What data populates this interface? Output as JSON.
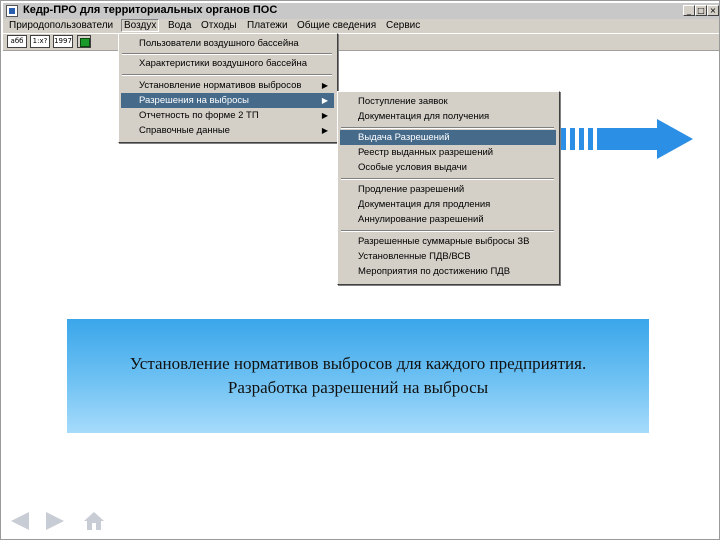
{
  "window": {
    "title": "Кедр-ПРО для территориальных органов ПОС"
  },
  "menubar": {
    "items": [
      "Природопользователи",
      "Воздух",
      "Вода",
      "Отходы",
      "Платежи",
      "Общие сведения",
      "Сервис"
    ],
    "active": "Воздух"
  },
  "toolbar": {
    "buttons": [
      "абб",
      "1:x?",
      "1997",
      ""
    ]
  },
  "air_menu": {
    "items": [
      {
        "label": "Пользователи воздушного бассейна",
        "submenu": false
      },
      {
        "label": "Характеристики воздушного бассейна",
        "submenu": false
      },
      {
        "label": "Установление нормативов выбросов",
        "submenu": true
      },
      {
        "label": "Разрешения на выбросы",
        "submenu": true,
        "highlighted": true
      },
      {
        "label": "Отчетность по форме 2 ТП",
        "submenu": true
      },
      {
        "label": "Справочные данные",
        "submenu": true
      }
    ]
  },
  "permits_menu": {
    "items": [
      {
        "label": "Поступление заявок"
      },
      {
        "label": "Документация для получения"
      },
      {
        "label": "Выдача Разрешений",
        "highlighted": true
      },
      {
        "label": "Реестр выданных разрешений"
      },
      {
        "label": "Особые условия выдачи"
      },
      {
        "label": "Продление разрешений"
      },
      {
        "label": "Документация для продления"
      },
      {
        "label": "Аннулирование разрешений"
      },
      {
        "label": "Разрешенные суммарные выбросы ЗВ"
      },
      {
        "label": "Установленные ПДВ/ВСВ"
      },
      {
        "label": "Мероприятия по достижению ПДВ"
      }
    ]
  },
  "caption": {
    "line1": "Установление нормативов выбросов для каждого предприятия.",
    "line2": "Разработка разрешений на выбросы"
  },
  "colors": {
    "menu_highlight": "#456a8a",
    "arrow_blue": "#2b8fe6",
    "caption_box_top": "#3aa6ea",
    "caption_box_bottom": "#a6dbfb",
    "nav_gray": "#c8ccd4"
  },
  "icons": {
    "big_arrow": "right-arrow-icon",
    "nav_back": "back-triangle-icon",
    "nav_forward": "forward-triangle-icon",
    "nav_home": "home-icon"
  }
}
